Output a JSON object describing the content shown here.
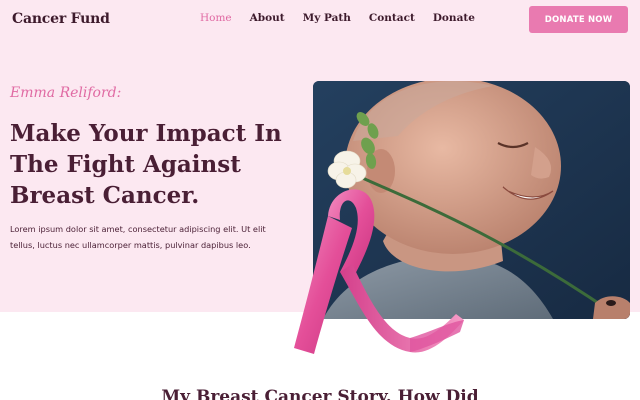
{
  "header": {
    "logo": "Cancer Fund",
    "nav": [
      "Home",
      "About",
      "My Path",
      "Contact",
      "Donate"
    ],
    "active_nav": "Home",
    "cta_label": "DONATE NOW"
  },
  "hero": {
    "signature": "Emma Reliford:",
    "headline": "Make Your Impact In The Fight Against Breast Cancer.",
    "body": "Lorem ipsum dolor sit amet, consectetur adipiscing elit. Ut elit tellus, luctus nec ullamcorper mattis, pulvinar dapibus leo."
  },
  "section": {
    "title": "My Breast Cancer Story. How Did"
  },
  "colors": {
    "hero_bg": "#fce8f1",
    "accent": "#e97ab0",
    "heading": "#4a1f35"
  },
  "icons": [
    "pink-ribbon-icon"
  ]
}
